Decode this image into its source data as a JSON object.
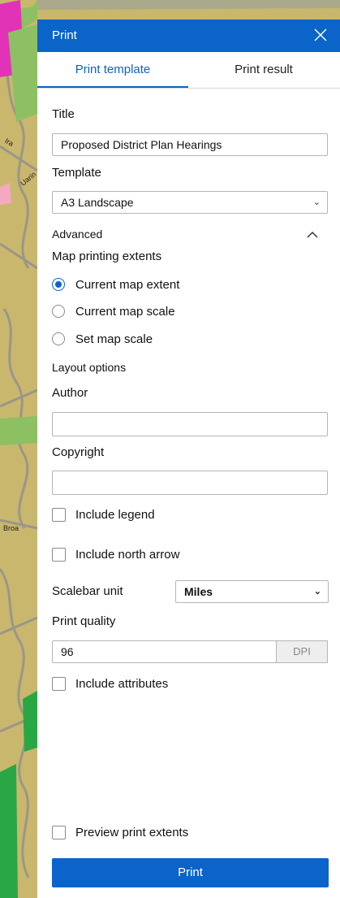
{
  "map": {
    "labels": [
      "Uarin",
      "Broa",
      "Ira"
    ],
    "colors": {
      "base": "#c9b76e",
      "road": "#9a9a9a",
      "green": "#8cc063",
      "magenta": "#e233b8",
      "pink": "#f4a9c0",
      "dark_green": "#2aa745"
    }
  },
  "panel": {
    "title": "Print",
    "close_icon": "close-icon",
    "tabs": [
      {
        "label": "Print template",
        "active": true
      },
      {
        "label": "Print result",
        "active": false
      }
    ],
    "title_label": "Title",
    "title_value": "Proposed District Plan Hearings",
    "template_label": "Template",
    "template_value": "A3 Landscape",
    "advanced_label": "Advanced",
    "extents_label": "Map printing extents",
    "extents_options": [
      "Current map extent",
      "Current map scale",
      "Set map scale"
    ],
    "extents_selected": "Current map extent",
    "layout_label": "Layout options",
    "author_label": "Author",
    "author_value": "",
    "copyright_label": "Copyright",
    "copyright_value": "",
    "include_legend": "Include legend",
    "include_north_arrow": "Include north arrow",
    "scalebar_label": "Scalebar unit",
    "scalebar_value": "Miles",
    "quality_label": "Print quality",
    "quality_value": "96",
    "dpi_label": "DPI",
    "include_attributes": "Include attributes",
    "preview_extents": "Preview print extents",
    "print_button": "Print",
    "accent": "#0a64c9"
  }
}
